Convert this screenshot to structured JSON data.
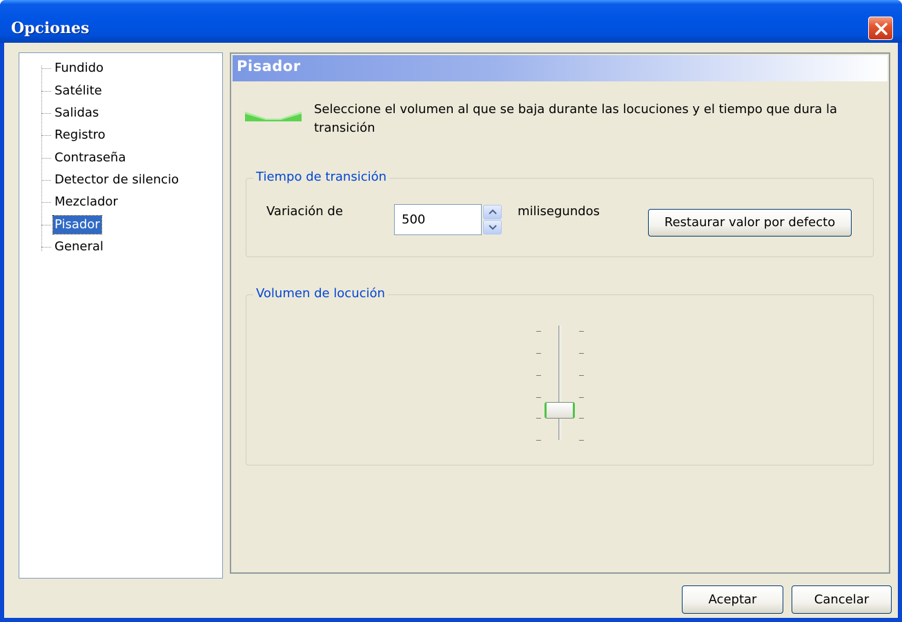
{
  "window": {
    "title": "Opciones",
    "close_icon": "close-icon"
  },
  "tree": {
    "items": [
      {
        "label": "Fundido",
        "selected": false
      },
      {
        "label": "Satélite",
        "selected": false
      },
      {
        "label": "Salidas",
        "selected": false
      },
      {
        "label": "Registro",
        "selected": false
      },
      {
        "label": "Contraseña",
        "selected": false
      },
      {
        "label": "Detector de silencio",
        "selected": false
      },
      {
        "label": "Mezclador",
        "selected": false
      },
      {
        "label": "Pisador",
        "selected": true
      },
      {
        "label": "General",
        "selected": false
      }
    ]
  },
  "panel": {
    "title": "Pisador",
    "icon": "ducking-icon",
    "description": "Seleccione el volumen al que se baja durante las locuciones y el tiempo que dura la transición",
    "transition_group": {
      "legend": "Tiempo de transición",
      "label": "Variación de",
      "value": "500",
      "unit": "milisegundos",
      "restore_button": "Restaurar valor por defecto"
    },
    "volume_group": {
      "legend": "Volumen de locución",
      "slider_level": 0.2
    }
  },
  "footer": {
    "ok_label": "Aceptar",
    "cancel_label": "Cancelar"
  },
  "colors": {
    "titlebar": "#0054e3",
    "selection": "#316ac5",
    "legend": "#0046d5",
    "accent_green": "#4fc448"
  }
}
